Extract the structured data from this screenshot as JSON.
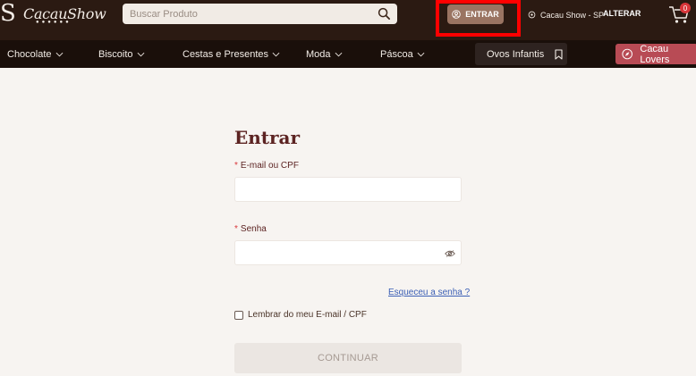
{
  "header": {
    "logo_text": "CacauShow",
    "logo_mark": "S",
    "search_placeholder": "Buscar Produto",
    "login_label": "ENTRAR",
    "location_label": "Cacau Show - SP",
    "change_location_label": "ALTERAR",
    "cart_count": "0"
  },
  "nav": {
    "items": [
      {
        "label": "Chocolate"
      },
      {
        "label": "Biscoito"
      },
      {
        "label": "Cestas e Presentes"
      },
      {
        "label": "Moda"
      },
      {
        "label": "Páscoa"
      }
    ],
    "ovos_label": "Ovos Infantis",
    "lovers_label": "Cacau Lovers"
  },
  "login": {
    "title": "Entrar",
    "email_label": "E-mail ou CPF",
    "email_value": "",
    "password_label": "Senha",
    "password_value": "",
    "required_mark": "*",
    "forgot_label": "Esqueceu a senha ?",
    "remember_label": "Lembrar do meu E-mail / CPF",
    "submit_label": "CONTINUAR"
  },
  "colors": {
    "header_bg": "#2b1a12",
    "nav_bg": "#1a0f0a",
    "login_button": "#9a7462",
    "lovers_button": "#b84b55",
    "title": "#5c2322",
    "highlight": "#ff0000"
  }
}
